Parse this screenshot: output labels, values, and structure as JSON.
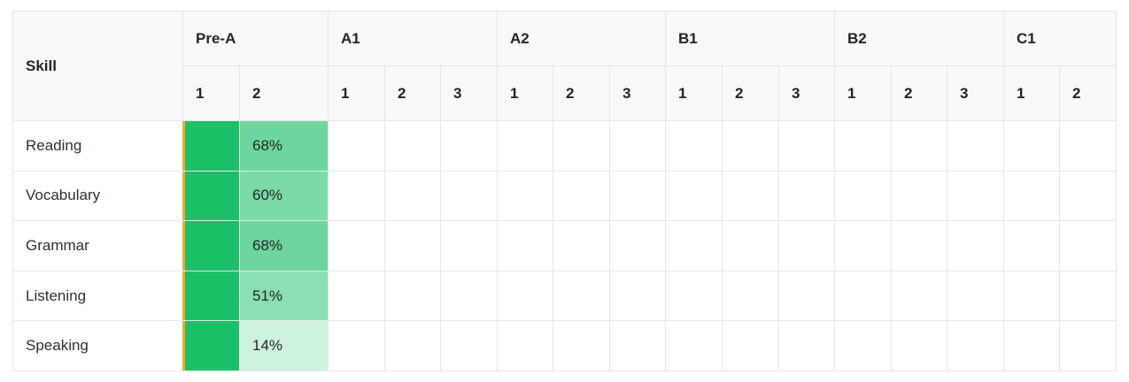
{
  "table": {
    "skill_header": "Skill",
    "bands": [
      {
        "label": "Pre-A",
        "sublevels": [
          "1",
          "2"
        ]
      },
      {
        "label": "A1",
        "sublevels": [
          "1",
          "2",
          "3"
        ]
      },
      {
        "label": "A2",
        "sublevels": [
          "1",
          "2",
          "3"
        ]
      },
      {
        "label": "B1",
        "sublevels": [
          "1",
          "2",
          "3"
        ]
      },
      {
        "label": "B2",
        "sublevels": [
          "1",
          "2",
          "3"
        ]
      },
      {
        "label": "C1",
        "sublevels": [
          "1",
          "2"
        ]
      }
    ],
    "rows": [
      {
        "skill": "Reading",
        "completed": "",
        "progress": "68%",
        "progress_value": 68
      },
      {
        "skill": "Vocabulary",
        "completed": "",
        "progress": "60%",
        "progress_value": 60
      },
      {
        "skill": "Grammar",
        "completed": "",
        "progress": "68%",
        "progress_value": 68
      },
      {
        "skill": "Listening",
        "completed": "",
        "progress": "51%",
        "progress_value": 51
      },
      {
        "skill": "Speaking",
        "completed": "",
        "progress": "14%",
        "progress_value": 14
      }
    ],
    "colors": {
      "complete": "#1cc068",
      "current_marker": "#e0b32a",
      "header_bg": "#f8f9fb",
      "grid": "#e4e6ea"
    }
  }
}
